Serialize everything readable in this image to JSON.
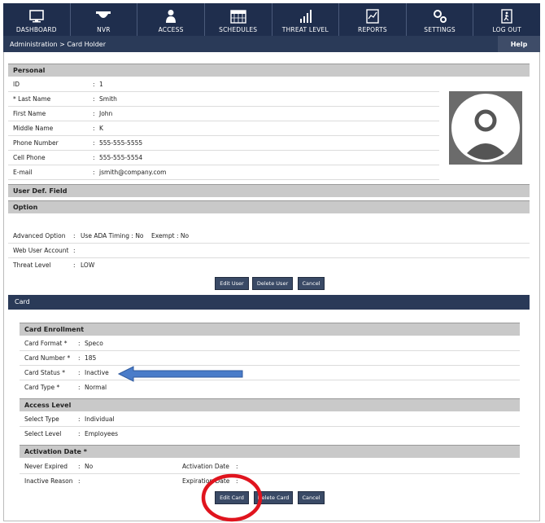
{
  "nav": [
    {
      "label": "DASHBOARD",
      "icon": "monitor-icon"
    },
    {
      "label": "NVR",
      "icon": "camera-dome-icon"
    },
    {
      "label": "ACCESS",
      "icon": "person-icon"
    },
    {
      "label": "SCHEDULES",
      "icon": "calendar-icon"
    },
    {
      "label": "THREAT LEVEL",
      "icon": "bar-level-icon"
    },
    {
      "label": "REPORTS",
      "icon": "report-icon"
    },
    {
      "label": "SETTINGS",
      "icon": "gear-icon"
    },
    {
      "label": "LOG OUT",
      "icon": "exit-icon"
    }
  ],
  "breadcrumb": "Administration > Card Holder",
  "help_label": "Help",
  "personal": {
    "title": "Personal",
    "rows": [
      {
        "label": "ID",
        "value": "1"
      },
      {
        "label": "* Last Name",
        "value": "Smith"
      },
      {
        "label": "First Name",
        "value": "John"
      },
      {
        "label": "Middle Name",
        "value": "K"
      },
      {
        "label": "Phone Number",
        "value": "555-555-5555"
      },
      {
        "label": "Cell Phone",
        "value": "555-555-5554"
      },
      {
        "label": "E-mail",
        "value": "jsmith@company.com"
      }
    ]
  },
  "user_def_title": "User Def. Field",
  "option": {
    "title": "Option",
    "advanced_label": "Advanced Option",
    "ada_timing": "Use ADA Timing : No",
    "exempt": "Exempt : No",
    "web_user_label": "Web User Account",
    "web_user_value": "",
    "threat_label": "Threat Level",
    "threat_value": "LOW"
  },
  "user_buttons": {
    "edit": "Edit User",
    "delete": "Delete User",
    "cancel": "Cancel"
  },
  "card_title": "Card",
  "card_enrollment": {
    "title": "Card Enrollment",
    "rows": [
      {
        "label": "Card Format *",
        "value": "Speco"
      },
      {
        "label": "Card Number *",
        "value": "185"
      },
      {
        "label": "Card Status *",
        "value": "Inactive"
      },
      {
        "label": "Card Type *",
        "value": "Normal"
      }
    ]
  },
  "access_level": {
    "title": "Access Level",
    "rows": [
      {
        "label": "Select Type",
        "value": "Individual"
      },
      {
        "label": "Select Level",
        "value": "Employees"
      }
    ]
  },
  "activation": {
    "title": "Activation Date *",
    "never_expired_label": "Never Expired",
    "never_expired_value": "No",
    "activation_date_label": "Activation Date",
    "activation_date_value": "",
    "inactive_reason_label": "Inactive Reason",
    "inactive_reason_value": "",
    "expiration_date_label": "Expiration Date",
    "expiration_date_value": ""
  },
  "card_buttons": {
    "edit": "Edit Card",
    "delete": "Delete Card",
    "cancel": "Cancel"
  },
  "colors": {
    "nav_bg": "#1f2e4d",
    "button_bg": "#3a4a66",
    "arrow": "#4a7cc9",
    "highlight_circle": "#e0141e"
  }
}
